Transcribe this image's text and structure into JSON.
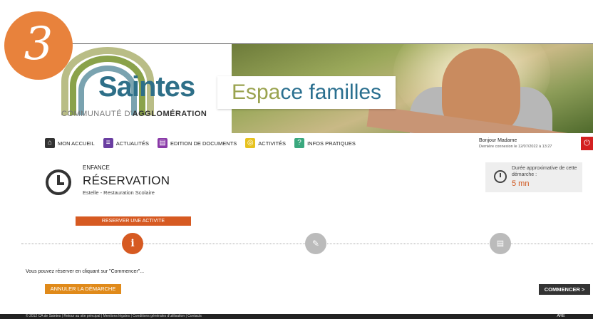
{
  "step_number": "3",
  "logo": {
    "town": "Saintes",
    "community_prefix": "COMMUNAUTÉ D'",
    "community_bold": "AGGLOMÉRATION"
  },
  "brand": {
    "part_a": "Espa",
    "part_a_highlight": "ce",
    "part_b": "familles"
  },
  "nav": {
    "items": [
      {
        "label": "MON ACCUEIL",
        "icon": "home-icon"
      },
      {
        "label": "ACTUALITÉS",
        "icon": "news-icon"
      },
      {
        "label": "EDITION DE DOCUMENTS",
        "icon": "printer-icon"
      },
      {
        "label": "ACTIVITÉS",
        "icon": "activities-icon"
      },
      {
        "label": "INFOS PRATIQUES",
        "icon": "info-icon"
      }
    ]
  },
  "user": {
    "greeting": "Bonjour Madame",
    "last_login": "Dernière connexion le 12/07/2022 à 13:27"
  },
  "section": {
    "category": "ENFANCE",
    "title": "RÉSERVATION",
    "subtitle": "Estelle - Restauration Scolaire"
  },
  "duration": {
    "label": "Durée approximative de cette démarche :",
    "value": "5 mn"
  },
  "action_label": "RESERVER UNE ACTIVITE",
  "stepper": {
    "step1_icon": "info-icon",
    "step2_icon": "pencil-icon",
    "step3_icon": "list-icon"
  },
  "instruction": "Vous pouvez réserver en cliquant sur \"Commencer\"...",
  "buttons": {
    "cancel": "ANNULER LA DÉMARCHE",
    "start": "COMMENCER >"
  },
  "footer": {
    "text": "© 2012 CA de Saintes | Retour au site principal | Mentions légales | Conditions générales d'utilisation | Contacts",
    "badge": "ARE"
  }
}
